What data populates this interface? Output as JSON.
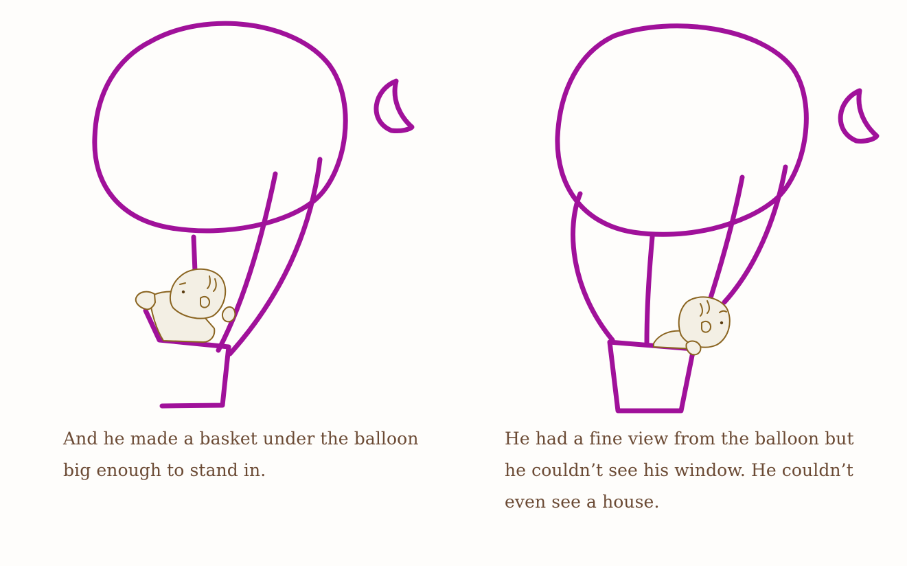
{
  "pages": [
    {
      "caption": "And he made a basket under the balloon big enough to stand in.",
      "illustration": "boy-building-balloon-basket"
    },
    {
      "caption": "He had a fine view from the balloon but he couldn’t see his window. He couldn’t even see a house.",
      "illustration": "boy-riding-balloon-basket"
    }
  ],
  "colors": {
    "crayon": "#a0119a",
    "text": "#6b4a34",
    "background": "#fefdfb"
  }
}
